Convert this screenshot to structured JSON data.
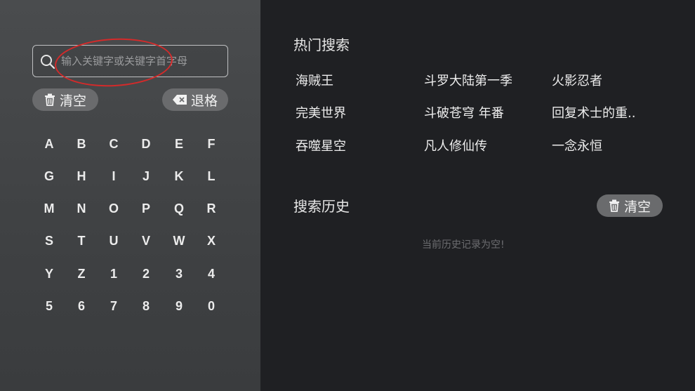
{
  "search": {
    "placeholder": "输入关键字或关键字首字母",
    "value": ""
  },
  "actions": {
    "clear_label": "清空",
    "backspace_label": "退格"
  },
  "keyboard": {
    "keys": [
      "A",
      "B",
      "C",
      "D",
      "E",
      "F",
      "G",
      "H",
      "I",
      "J",
      "K",
      "L",
      "M",
      "N",
      "O",
      "P",
      "Q",
      "R",
      "S",
      "T",
      "U",
      "V",
      "W",
      "X",
      "Y",
      "Z",
      "1",
      "2",
      "3",
      "4",
      "5",
      "6",
      "7",
      "8",
      "9",
      "0"
    ]
  },
  "hot_search": {
    "title": "热门搜索",
    "items": [
      "海贼王",
      "斗罗大陆第一季",
      "火影忍者",
      "完美世界",
      "斗破苍穹 年番",
      "回复术士的重..",
      "吞噬星空",
      "凡人修仙传",
      "一念永恒"
    ]
  },
  "history": {
    "title": "搜索历史",
    "clear_label": "清空",
    "empty_text": "当前历史记录为空!"
  },
  "colors": {
    "annotation": "#d42a2a",
    "left_panel": "#444648",
    "right_panel": "#1f2023",
    "pill": "#6a6b6d"
  },
  "icons": {
    "search": "search-icon",
    "trash": "trash-icon",
    "backspace": "backspace-icon"
  }
}
